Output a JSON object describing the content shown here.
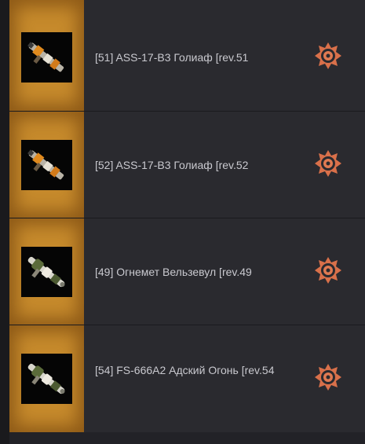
{
  "items": [
    {
      "name": "[51] ASS-17-B3 Голиаф [rev.51",
      "weapon_icon": "rifle-icon",
      "badge_icon": "fire-seal-icon"
    },
    {
      "name": "[52] ASS-17-B3 Голиаф [rev.52",
      "weapon_icon": "rifle-icon",
      "badge_icon": "fire-seal-icon"
    },
    {
      "name": "[49] Огнемет Вельзевул [rev.49",
      "weapon_icon": "flamethrower-icon",
      "badge_icon": "fire-seal-icon"
    },
    {
      "name": "[54] FS-666A2 Адский Огонь [rev.54",
      "weapon_icon": "flamethrower-icon",
      "badge_icon": "fire-seal-icon"
    }
  ]
}
